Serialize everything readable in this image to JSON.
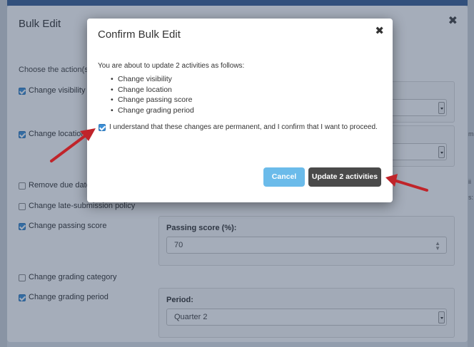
{
  "bulk_edit": {
    "title": "Bulk Edit",
    "close": "✖",
    "prompt": "Choose the action(s)",
    "options": [
      {
        "label": "Change visibility",
        "checked": true
      },
      {
        "label": "Change location",
        "checked": true
      },
      {
        "label": "Remove due date",
        "checked": false
      },
      {
        "label": "Change late-submission policy",
        "checked": false
      },
      {
        "label": "Change passing score",
        "checked": true
      },
      {
        "label": "Change grading category",
        "checked": false
      },
      {
        "label": "Change grading period",
        "checked": true
      }
    ],
    "passing_score": {
      "label": "Passing score (%):",
      "value": "70"
    },
    "period": {
      "label": "Period:",
      "value": "Quarter 2"
    }
  },
  "confirm": {
    "title": "Confirm Bulk Edit",
    "close": "✖",
    "intro": "You are about to update 2 activities as follows:",
    "changes": [
      "Change visibility",
      "Change location",
      "Change passing score",
      "Change grading period"
    ],
    "acknowledge": {
      "checked": true,
      "text": "I understand that these changes are permanent, and I confirm that I want to proceed."
    },
    "cancel_label": "Cancel",
    "update_label": "Update 2 activities"
  },
  "colors": {
    "checkbox_checked": "#3d8fd6",
    "cancel_button": "#6bbbea",
    "update_button": "#4a4a4a",
    "annotation_arrow": "#c0242a",
    "top_bar": "#3a5f95"
  },
  "icons": {
    "close": "close-icon",
    "select_arrow": "chevron-down-icon",
    "spinner": "spinner-arrows-icon"
  }
}
